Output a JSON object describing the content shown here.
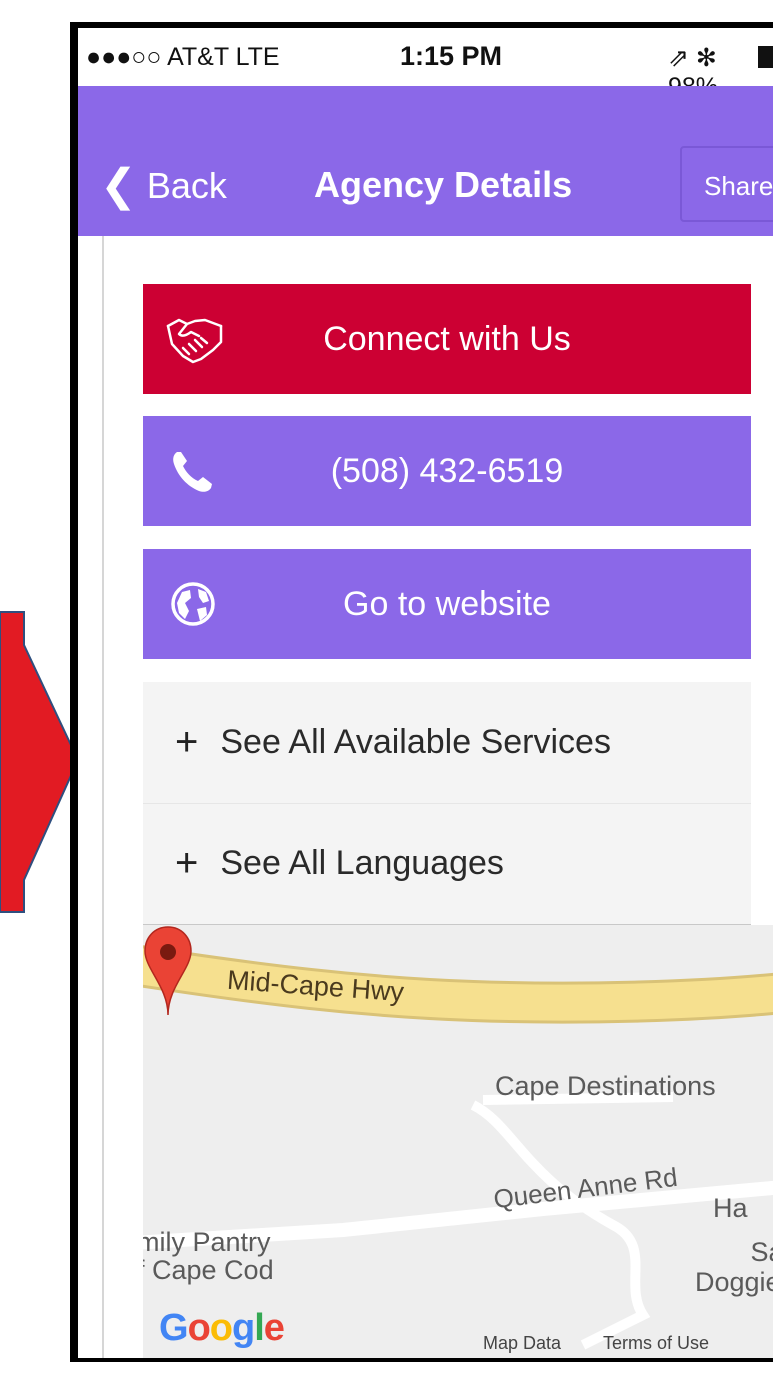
{
  "status_bar": {
    "carrier": "●●●○○ AT&T  LTE",
    "time": "1:15 PM",
    "right": "⇗ ✻ 98%"
  },
  "navbar": {
    "back_label": "Back",
    "title": "Agency Details",
    "share_label": "Share"
  },
  "actions": {
    "connect_label": "Connect with Us",
    "phone_label": "(508) 432-6519",
    "website_label": "Go to website"
  },
  "accordion": {
    "services_label": "See All Available Services",
    "languages_label": "See All Languages"
  },
  "map": {
    "highway": "Mid-Cape Hwy",
    "place_1": "Cape Destinations",
    "road": "Queen Anne Rd",
    "partial_1": "Ha",
    "pantry_line1": "mily Pantry",
    "pantry_line2": "f Cape Cod",
    "partial_2_line1": "Sanc",
    "partial_2_line2": "Doggie Pl",
    "map_data": "Map Data",
    "terms": "Terms of Use",
    "google_letters": [
      "G",
      "o",
      "o",
      "g",
      "l",
      "e"
    ]
  },
  "colors": {
    "nav_purple": "#8b68e8",
    "connect_red": "#cc0033",
    "arrow_red": "#e21b23"
  },
  "icons": [
    "chevron-left-icon",
    "handshake-icon",
    "phone-icon",
    "globe-icon",
    "plus-icon",
    "map-pin-icon",
    "navigation-arrow-icon",
    "bluetooth-icon",
    "battery-icon"
  ]
}
